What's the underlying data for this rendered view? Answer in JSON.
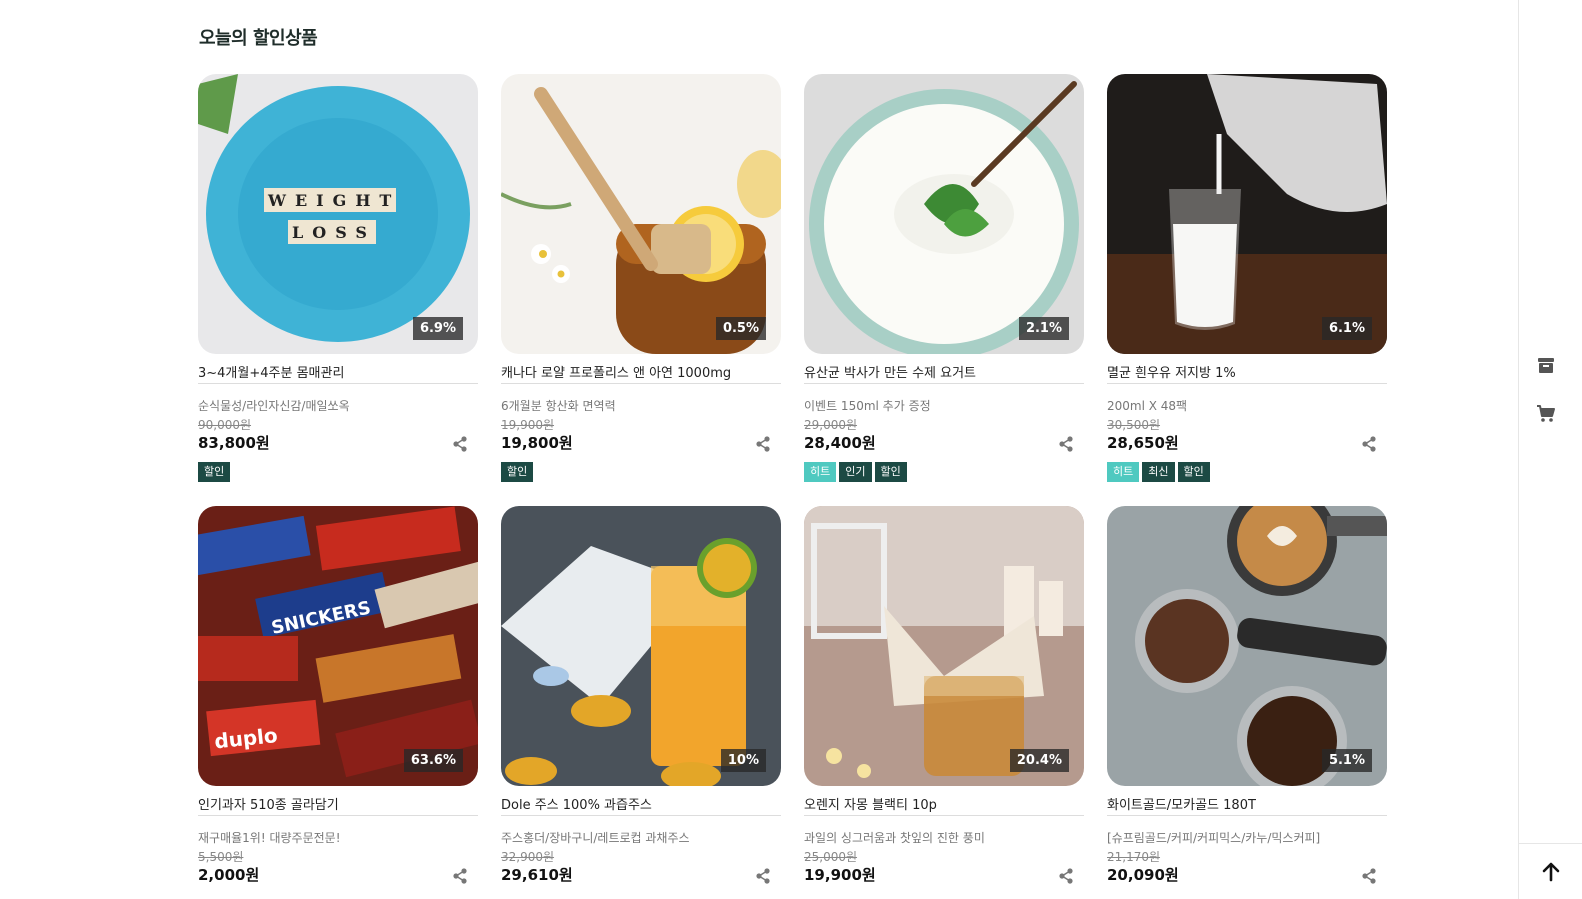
{
  "section": {
    "title": "오늘의 할인상품"
  },
  "products": [
    {
      "name": "3~4개월+4주분 몸매관리",
      "desc": "순식물성/라인자신감/매일쏘옥",
      "original_price": "90,000원",
      "price": "83,800원",
      "rate": "6.9%",
      "badges": [
        {
          "label": "할인",
          "kind": "sale"
        }
      ],
      "image": "weight-loss-plate"
    },
    {
      "name": "캐나다 로얄 프로폴리스 앤 아연 1000mg",
      "desc": "6개월분 항산화 면역력",
      "original_price": "19,900원",
      "price": "19,800원",
      "rate": "0.5%",
      "badges": [
        {
          "label": "할인",
          "kind": "sale"
        }
      ],
      "image": "honey-jar"
    },
    {
      "name": "유산균 박사가 만든 수제 요거트",
      "desc": "이벤트 150ml 추가 증정",
      "original_price": "29,000원",
      "price": "28,400원",
      "rate": "2.1%",
      "badges": [
        {
          "label": "히트",
          "kind": "hit"
        },
        {
          "label": "인기",
          "kind": "pop"
        },
        {
          "label": "할인",
          "kind": "sale"
        }
      ],
      "image": "yogurt-bowl"
    },
    {
      "name": "멸균 흰우유 저지방 1%",
      "desc": "200ml X 48팩",
      "original_price": "30,500원",
      "price": "28,650원",
      "rate": "6.1%",
      "badges": [
        {
          "label": "히트",
          "kind": "hit"
        },
        {
          "label": "최신",
          "kind": "new"
        },
        {
          "label": "할인",
          "kind": "sale"
        }
      ],
      "image": "milk-glass"
    },
    {
      "name": "인기과자 510종 골라담기",
      "desc": "재구매율1위! 대량주문전문!",
      "original_price": "5,500원",
      "price": "2,000원",
      "rate": "63.6%",
      "badges": [],
      "image": "candy-bars"
    },
    {
      "name": "Dole 주스 100% 과즙주스",
      "desc": "주스홍더/장바구니/레트로컵 과채주스",
      "original_price": "32,900원",
      "price": "29,610원",
      "rate": "10%",
      "badges": [],
      "image": "orange-juice"
    },
    {
      "name": "오렌지 자몽 블랙티 10p",
      "desc": "과일의 싱그러움과 찻잎의 진한 풍미",
      "original_price": "25,000원",
      "price": "19,900원",
      "rate": "20.4%",
      "badges": [],
      "image": "black-tea"
    },
    {
      "name": "화이트골드/모카골드 180T",
      "desc": "[슈프림골드/커피/커피믹스/카누/믹스커피]",
      "original_price": "21,170원",
      "price": "20,090원",
      "rate": "5.1%",
      "badges": [],
      "image": "coffee-beans"
    }
  ],
  "sidebar": {
    "icons": [
      "archive-icon",
      "cart-icon"
    ],
    "top_button": "arrow-up-icon"
  },
  "colors": {
    "badge_hit": "#4fc9c0",
    "badge_dark": "#1c4a44",
    "title": "#1f2d2a"
  }
}
